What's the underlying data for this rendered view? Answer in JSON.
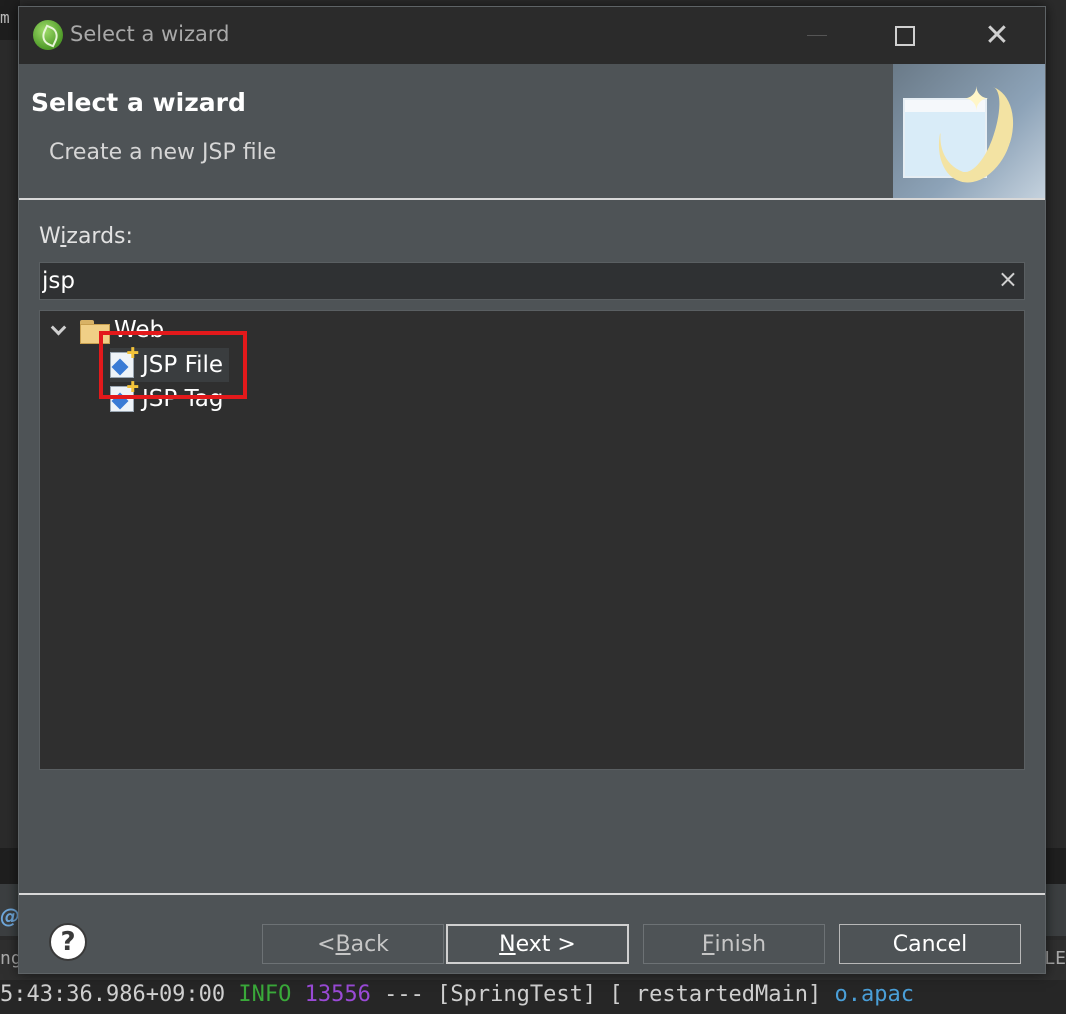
{
  "background": {
    "top_fragment": "m",
    "at_symbol": "@",
    "left_fragment": "ng",
    "right_fragment": "ELE",
    "console": {
      "timestamp": "5:43:36.986+09:00",
      "level": "INFO",
      "pid": "13556",
      "separator": "---",
      "app": "[SpringTest]",
      "thread": "[  restartedMain]",
      "logger": "o.apac"
    }
  },
  "dialog": {
    "window_title": "Select a wizard",
    "header_title": "Select a wizard",
    "header_subtitle": "Create a new JSP file",
    "wizards_label_prefix": "W",
    "wizards_label_underlined": "i",
    "wizards_label_suffix": "zards:",
    "filter_value": "jsp",
    "clear_icon": "×",
    "tree": {
      "category": "Web",
      "items": [
        "JSP File",
        "JSP Tag"
      ],
      "selected": "JSP File"
    },
    "buttons": {
      "back_prefix": "< ",
      "back_mnemonic": "B",
      "back_suffix": "ack",
      "next_mnemonic": "N",
      "next_suffix": "ext >",
      "finish_mnemonic": "F",
      "finish_suffix": "inish",
      "cancel": "Cancel"
    },
    "help_icon": "?"
  },
  "colors": {
    "highlight": "#e3191b",
    "dialog_bg": "#4e5356",
    "tree_bg": "#2f2f2f"
  }
}
